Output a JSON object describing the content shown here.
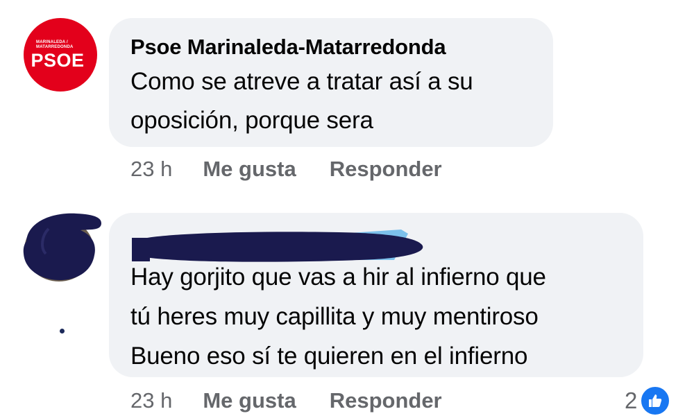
{
  "comments": [
    {
      "avatar": {
        "line1": "MARINALEDA /",
        "line2": "MATARREDONDA",
        "logo": "PSOE"
      },
      "author": "Psoe Marinaleda-Matarredonda",
      "text_lines": [
        "Como se atreve a tratar así a su",
        "oposición, porque sera"
      ],
      "time": "23 h",
      "like_label": "Me gusta",
      "reply_label": "Responder"
    },
    {
      "author": "",
      "text_lines": [
        "Hay gorjito que vas a hir al infierno que",
        "tú heres muy capillita y muy mentiroso",
        "Bueno eso sí te quieren en el infierno"
      ],
      "time": "23 h",
      "like_label": "Me gusta",
      "reply_label": "Responder",
      "reaction_count": "2",
      "reaction_icon": "thumbs-up-icon"
    }
  ],
  "colors": {
    "psoe_red": "#e3001b",
    "bubble_bg": "#f0f2f5",
    "meta_text": "#65676b",
    "like_blue": "#1877f2",
    "redaction": "#1a1a4e"
  }
}
